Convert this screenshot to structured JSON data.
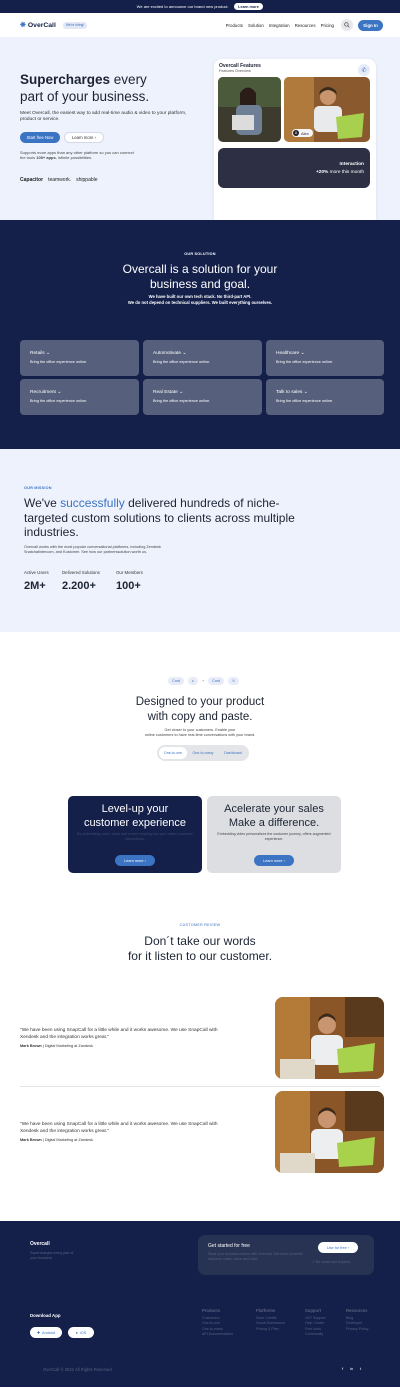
{
  "announcement": {
    "text": "We are excited to announce our brand new product.",
    "link": "Learn more"
  },
  "nav": {
    "brand": "OverCall",
    "hiring": "We're hiring!",
    "menu": [
      "Products",
      "Solution",
      "Integration",
      "Resources",
      "Pricing"
    ],
    "sign_in": "Sign In"
  },
  "hero": {
    "title_bold": "Supercharges",
    "title_rest_1": " every",
    "title_line2": "part of your business.",
    "subtitle": "Meet Overcall, the easiest way to add real-time audio & video to your platform, product or service.",
    "primary_btn": "Start free Now",
    "secondary_btn": "Learn more",
    "support_pre": "Supports more apps than any other platform so you can connect the tools",
    "support_bold": "100+ apps",
    "support_post": ", infinite possibilities.",
    "partners": [
      "Capacitor",
      "teamwork.",
      "shippable"
    ],
    "card": {
      "title": "Overcall Features",
      "subtitle": "Features Overview",
      "caller_name": "Alex",
      "dark_title": "Interaction",
      "dark_stat": "+20%",
      "dark_stat_rest": " more this month"
    }
  },
  "solution": {
    "eyebrow": "OUR SOLUTION",
    "title_1": "Overcall is a solution for your",
    "title_2": "business and goal.",
    "desc_1": "We have built our own tech stack. No third-part API.",
    "desc_2": "We do not depend on technical suppliers. We built everything ourselves.",
    "tiles": [
      {
        "name": "Retails",
        "desc": "Bring the office experience online."
      },
      {
        "name": "Automotivate",
        "desc": "Bring the office experience online."
      },
      {
        "name": "Healthcare",
        "desc": "Bring the office experience online."
      },
      {
        "name": "Recruitment",
        "desc": "Bring the office experience online."
      },
      {
        "name": "Real Estate",
        "desc": "Bring the office experience online."
      },
      {
        "name": "Talk to sales",
        "desc": "Bring the office experience online."
      }
    ]
  },
  "mission": {
    "eyebrow": "OUR MISSION",
    "pre": "We've ",
    "highlight": "successfully",
    "post": " delivered hundreds of niche-targeted custom solutions to clients across multiple industries.",
    "desc": "Overcall works with the most popular conversational platforms, including Zendesk Snatchatintercom, and Kustomer. See how our partnerssolution worth us.",
    "stats": [
      {
        "label": "Active Users",
        "value": "2M+"
      },
      {
        "label": "Delivered Solutions",
        "value": "2.200+"
      },
      {
        "label": "Our Members",
        "value": "100+"
      }
    ]
  },
  "design": {
    "chips": [
      "Cmd",
      "c",
      "Cmd",
      "V"
    ],
    "op1": "+",
    "title_1": "Designed to your product",
    "title_2": "with copy and paste.",
    "desc_1": "Get closer to your customers. Enable your",
    "desc_2": "online customers to have real-time conversations with your brand.",
    "tabs": [
      "One-to-one",
      "One-to-many",
      "Dashboard"
    ],
    "cards": [
      {
        "title_1": "Level-up your",
        "title_2": "customer experience",
        "desc": "By embedding voice, video and screen sharing into your online customer interactions.",
        "btn": "Learn more"
      },
      {
        "title_1": "Acelerate your sales",
        "title_2": "Make a difference.",
        "desc": "Embedding video personalizes the customer journey, offers augmented experience.",
        "btn": "Learn more"
      }
    ]
  },
  "review": {
    "eyebrow": "CUSTOMER REVIEW",
    "title_1": "Don´t take our words",
    "title_2": "for it listen to our customer.",
    "items": [
      {
        "quote": "\"We have been using SnapCall for a little while and it works awesome. We use SnapCall with Xendesk and the integration works great.\"",
        "author": "Mark Brown",
        "role": " | Digital Marketing at Zandesk"
      },
      {
        "quote": "\"We have been using SnapCall for a little while and it works awesome. We use SnapCall with Xendesk and the integration works great.\"",
        "author": "Mark Brown",
        "role": " | Digital Marketing at Zandesk"
      }
    ]
  },
  "footer": {
    "brand": "Overcall",
    "tagline": "Supercharges every part of your business",
    "cta_title": "Get started for free",
    "cta_desc": "Steal your business online with Overcall. Get more powerful real-time video, voice and chat.",
    "cta_btn": "Use for free",
    "cta_note": "No credit card required",
    "download": "Download App",
    "stores": [
      "Android",
      "iOS"
    ],
    "columns": [
      {
        "head": "Products",
        "items": [
          "Customers",
          "One-to-one",
          "One-to-many",
          "API Documentation"
        ]
      },
      {
        "head": "Platforms",
        "items": [
          "Save Credits",
          "Social Dominance",
          "Pricing & Plan"
        ]
      },
      {
        "head": "Support",
        "items": [
          "24/7 Support",
          "Help Center",
          "Free tools",
          "Community"
        ]
      },
      {
        "head": "Resources",
        "items": [
          "Blog",
          "Developer",
          "Privacy Policy"
        ]
      }
    ],
    "copyright": "OverCall  ©  2022 All Rights Reserved"
  },
  "colors": {
    "navy": "#14204a",
    "accent": "#3b74c2",
    "light_bg": "#eef2fd",
    "tile": "#56607c"
  }
}
